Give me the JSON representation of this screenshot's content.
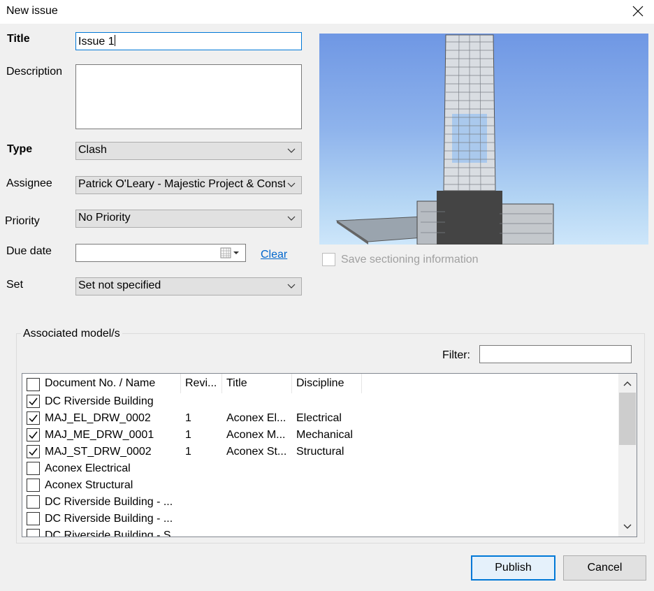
{
  "window": {
    "title": "New issue"
  },
  "form": {
    "title_label": "Title",
    "title_value": "Issue 1",
    "description_label": "Description",
    "description_value": "",
    "type_label": "Type",
    "type_value": "Clash",
    "assignee_label": "Assignee",
    "assignee_value": "Patrick O'Leary - Majestic Project & Const",
    "priority_label": "Priority",
    "priority_value": "No Priority",
    "due_date_label": "Due date",
    "due_date_value": "",
    "clear_link": "Clear",
    "set_label": "Set",
    "set_value": "Set not specified"
  },
  "preview": {
    "save_sectioning_label": "Save sectioning information",
    "save_sectioning_checked": false
  },
  "models": {
    "group_label": "Associated model/s",
    "filter_label": "Filter:",
    "filter_value": "",
    "columns": [
      "Document No. / Name",
      "Revi...",
      "Title",
      "Discipline"
    ],
    "rows": [
      {
        "checked": true,
        "name": "DC Riverside Building",
        "rev": "",
        "title": "",
        "discipline": ""
      },
      {
        "checked": true,
        "name": "MAJ_EL_DRW_0002",
        "rev": "1",
        "title": "Aconex El...",
        "discipline": "Electrical"
      },
      {
        "checked": true,
        "name": "MAJ_ME_DRW_0001",
        "rev": "1",
        "title": "Aconex M...",
        "discipline": "Mechanical"
      },
      {
        "checked": true,
        "name": "MAJ_ST_DRW_0002",
        "rev": "1",
        "title": "Aconex St...",
        "discipline": "Structural"
      },
      {
        "checked": false,
        "name": "Aconex Electrical",
        "rev": "",
        "title": "",
        "discipline": ""
      },
      {
        "checked": false,
        "name": "Aconex Structural",
        "rev": "",
        "title": "",
        "discipline": ""
      },
      {
        "checked": false,
        "name": "DC Riverside Building - ...",
        "rev": "",
        "title": "",
        "discipline": ""
      },
      {
        "checked": false,
        "name": "DC Riverside Building - ...",
        "rev": "",
        "title": "",
        "discipline": ""
      },
      {
        "checked": false,
        "name": "DC Riverside Building - S...",
        "rev": "",
        "title": "",
        "discipline": ""
      }
    ]
  },
  "buttons": {
    "publish": "Publish",
    "cancel": "Cancel"
  },
  "icons": {
    "close": "close-icon",
    "dropdown": "chevron-down-icon",
    "calendar": "calendar-icon",
    "scroll_up": "scroll-up-icon",
    "scroll_down": "scroll-down-icon",
    "checkmark": "checkmark-icon"
  },
  "colors": {
    "accent": "#0078d7",
    "link": "#0066cc",
    "sky_top": "#6f97e4",
    "sky_bottom": "#cde6fa"
  }
}
